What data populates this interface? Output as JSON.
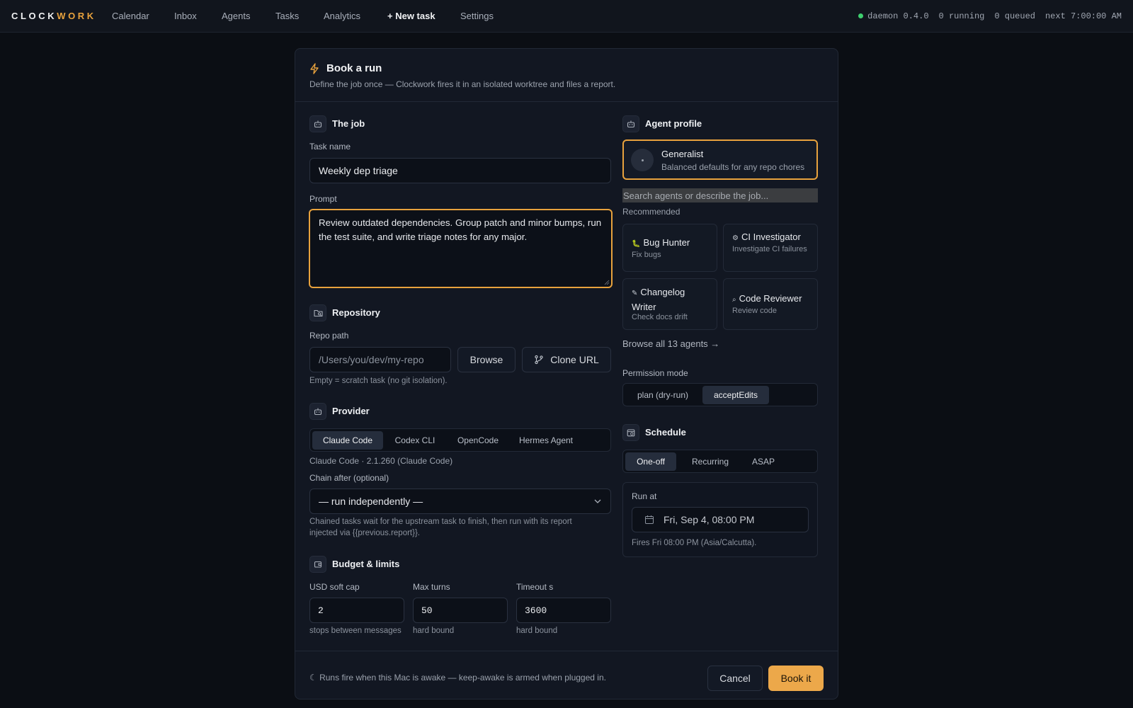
{
  "brand": {
    "part1": "CLOCK",
    "part2": "WORK",
    "accent": "#e8a23d"
  },
  "nav": {
    "items": [
      "Calendar",
      "Inbox",
      "Agents",
      "Tasks",
      "Analytics",
      "+ New task",
      "Settings"
    ]
  },
  "status": {
    "daemon": "daemon 0.4.0",
    "running": "0 running",
    "queued": "0 queued",
    "next": "next 7:00:00 AM",
    "dot_color": "#3ecf6e"
  },
  "dialog": {
    "title": "Book a run",
    "subtitle": "Define the job once — Clockwork fires it in an isolated worktree and files a report."
  },
  "job": {
    "section": "The job",
    "task_name_label": "Task name",
    "task_name_value": "Weekly dep triage",
    "prompt_label": "Prompt",
    "prompt_value": "Review outdated dependencies. Group patch and minor bumps, run the test suite, and write triage notes for any major."
  },
  "repo": {
    "section": "Repository",
    "path_label": "Repo path",
    "path_placeholder": "/Users/you/dev/my-repo",
    "browse_label": "Browse",
    "clone_label": "Clone URL",
    "hint": "Empty = scratch task (no git isolation)."
  },
  "provider": {
    "section": "Provider",
    "options": [
      "Claude Code",
      "Codex CLI",
      "OpenCode",
      "Hermes Agent"
    ],
    "selected": "Claude Code",
    "version": "Claude Code · 2.1.260 (Claude Code)",
    "chain_label": "Chain after (optional)",
    "chain_value": "— run independently —",
    "chain_hint_1": "Chained tasks wait for the upstream task to finish, then run with its report",
    "chain_hint_2": "injected via {{previous.report}}."
  },
  "budget": {
    "section": "Budget & limits",
    "fields": [
      {
        "label": "USD soft cap",
        "value": "2",
        "hint": "stops between messages"
      },
      {
        "label": "Max turns",
        "value": "50",
        "hint": "hard bound"
      },
      {
        "label": "Timeout s",
        "value": "3600",
        "hint": "hard bound"
      }
    ]
  },
  "agent": {
    "section": "Agent profile",
    "selected_name": "Generalist",
    "selected_desc": "Balanced defaults for any repo chores",
    "search_placeholder": "Search agents or describe the job...",
    "recommended_label": "Recommended",
    "cards": [
      {
        "glyph": "🐛",
        "name": "Bug Hunter",
        "desc": "Fix bugs"
      },
      {
        "glyph": "⚙",
        "name": "CI Investigator",
        "desc": "Investigate CI failures"
      },
      {
        "glyph": "✎",
        "name": "Changelog Writer",
        "desc": "Check docs drift"
      },
      {
        "glyph": "⌕",
        "name": "Code Reviewer",
        "desc": "Review code"
      }
    ],
    "browse_all": "Browse all 13 agents →"
  },
  "permission": {
    "label": "Permission mode",
    "options": [
      "plan (dry-run)",
      "acceptEdits"
    ],
    "selected": "acceptEdits"
  },
  "schedule": {
    "section": "Schedule",
    "options": [
      "One-off",
      "Recurring",
      "ASAP"
    ],
    "selected": "One-off",
    "run_at_label": "Run at",
    "run_at_value": "Fri, Sep 4, 08:00 PM",
    "fires_note": "Fires Fri 08:00 PM (Asia/Calcutta)."
  },
  "footer": {
    "note": "☾ Runs fire when this Mac is awake — keep-awake is armed when plugged in.",
    "cancel": "Cancel",
    "submit": "Book it"
  }
}
